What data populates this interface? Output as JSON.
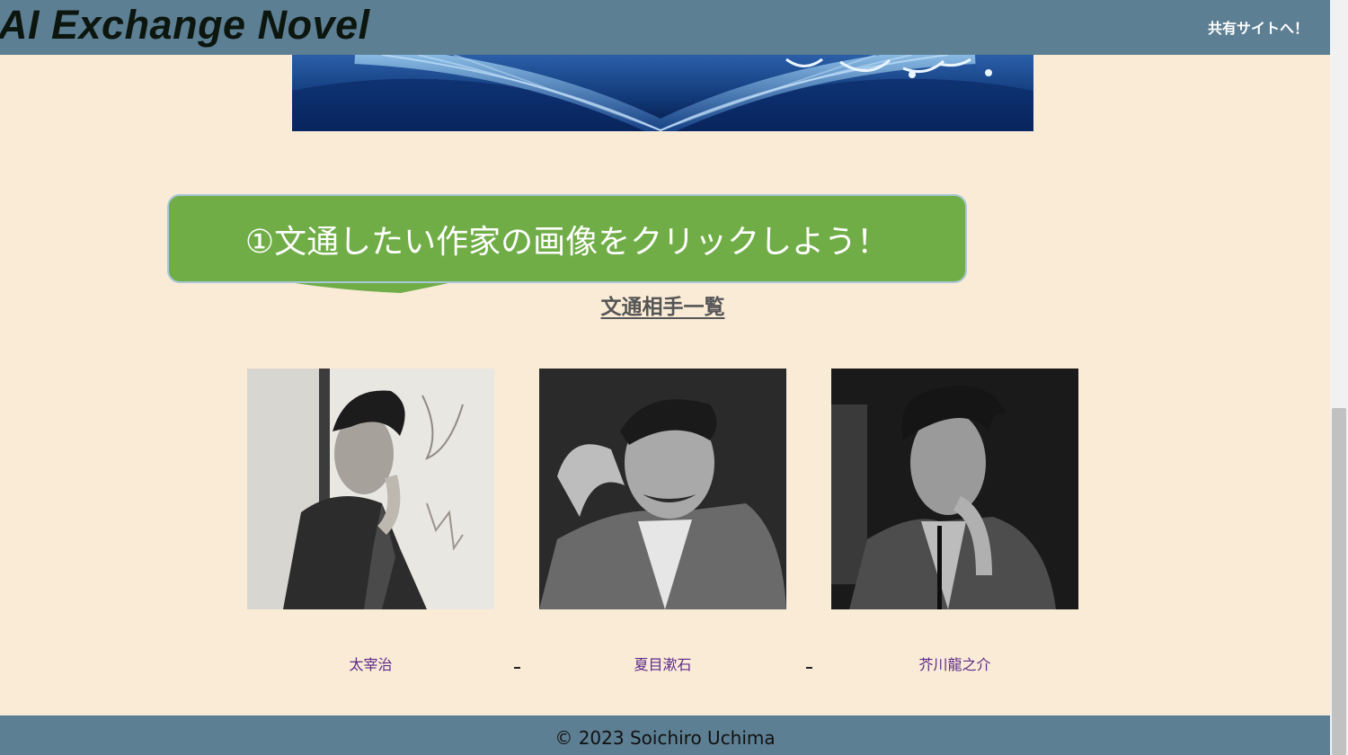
{
  "header": {
    "site_title": "AI Exchange Novel",
    "share_link": "共有サイトへ！"
  },
  "hero": {
    "alt": "open-book-banner"
  },
  "instruction": {
    "text": "①文通したい作家の画像をクリックしよう！"
  },
  "authors_section": {
    "heading": "文通相手一覧",
    "authors": [
      {
        "name": "太宰治",
        "photo": "dazai-portrait"
      },
      {
        "name": "夏目漱石",
        "photo": "natsume-portrait"
      },
      {
        "name": "芥川龍之介",
        "photo": "akutagawa-portrait"
      }
    ],
    "separator": "_"
  },
  "footer": {
    "copyright": "© 2023 Soichiro Uchima"
  },
  "colors": {
    "background": "#faebd7",
    "header": "#5d7f93",
    "bubble": "#70ad47",
    "link": "#5b2a86"
  }
}
